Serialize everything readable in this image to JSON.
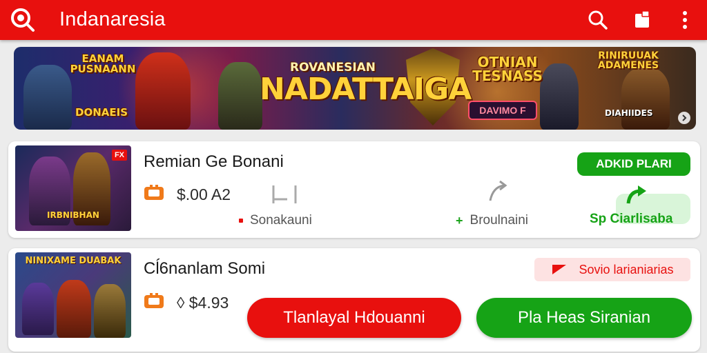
{
  "app": {
    "title": "Indanaresia",
    "icons": [
      "logo-search-icon",
      "search-icon",
      "bookmark-icon",
      "more-vertical-icon"
    ]
  },
  "banner": {
    "left_title": "EANAM PUSNAANN",
    "left_subtitle": "DONAEIS",
    "mid_small": "ROVANESIAN",
    "mid_big": "NADATTAIGA",
    "right_title": "OTNIAN TESNASS",
    "right_title_2": "RINIRUUAK ADAMENES",
    "right_tag": "DIAHIIDES",
    "cta": "DAVIMO F",
    "colors": {
      "cta_border": "#ff4d6a",
      "text_gold": "#ffd23a"
    }
  },
  "cards": [
    {
      "name": "Remian Ge Bonani",
      "price": "$.00 A2",
      "thumb_label": "IRBNIBHAN",
      "thumb_badge": "FX",
      "stat_left": "Sonakauni",
      "stat_right": "Broulnaini",
      "status_pill": "ADKID PLARI",
      "action_text": "Sp Ciarlisaba"
    },
    {
      "name": "Cĺ6nanlam Somi",
      "price": "$4.93",
      "thumb_label": "NINIXAME DUABAK",
      "tag": "Sovio larianiarias",
      "button_red": "Tlanlayal Hdouanni",
      "button_green": "Pla Heas Siranian"
    }
  ],
  "colors": {
    "brand_red": "#e8100e",
    "green": "#16a316",
    "price_icon": "#f07a1a"
  }
}
